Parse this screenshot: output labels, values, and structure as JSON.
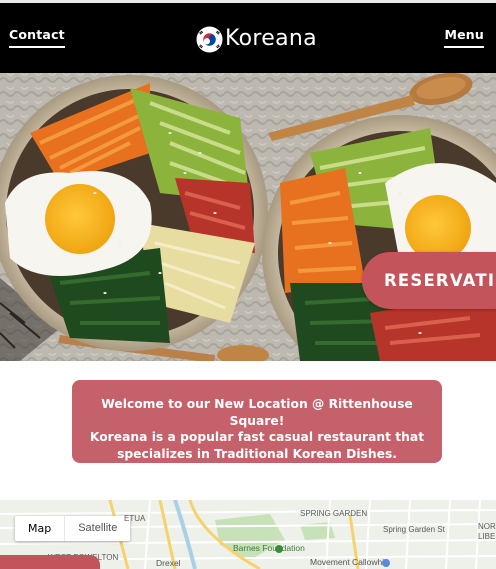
{
  "header": {
    "contact_label": "Contact",
    "brand_name": "Koreana",
    "menu_label": "Menu"
  },
  "hero": {
    "reservation_label": "RESERVATIO"
  },
  "welcome": {
    "line1": "Welcome to our New Location @ Rittenhouse Square!",
    "line2": "Koreana is a popular fast casual restaurant that",
    "line3": "specializes in Traditional Korean Dishes."
  },
  "map": {
    "type_map": "Map",
    "type_satellite": "Satellite",
    "labels": {
      "etua": "ETUA",
      "spring_garden_street": "SPRING GARDEN",
      "spring_garden_st": "Spring Garden St",
      "north_liberties_1": "NORT",
      "north_liberties_2": "LIBE",
      "barnes": "Barnes Foundation",
      "west_powelton": "WEST POWELTON",
      "drexel": "Drexel",
      "movement": "Movement Callowhill"
    }
  },
  "colors": {
    "header_bg": "#000000",
    "accent": "#c4545c",
    "welcome_bg": "#c4616a"
  }
}
